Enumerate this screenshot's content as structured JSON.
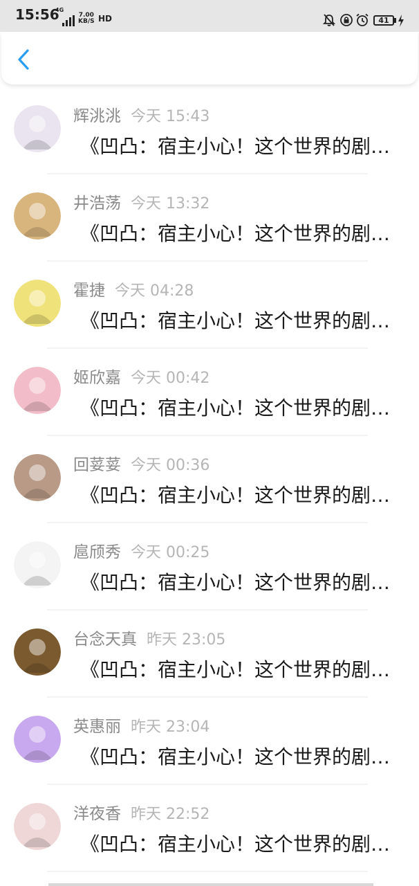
{
  "status_bar": {
    "time": "15:56",
    "network": "4G",
    "speed_value": "7.00",
    "speed_unit": "KB/S",
    "hd": "HD",
    "battery": "41"
  },
  "header": {
    "back_icon": "chevron-left-icon"
  },
  "messages": [
    {
      "name": "辉洮洮",
      "time": "今天 15:43",
      "text": "《凹凸：宿主小心！这个世界的剧情已经崩坏》",
      "avatar_color": "#e9e4ef"
    },
    {
      "name": "井浩荡",
      "time": "今天 13:32",
      "text": "《凹凸：宿主小心！这个世界的剧情已经崩坏》",
      "avatar_color": "#d9b57e"
    },
    {
      "name": "霍捷",
      "time": "今天 04:28",
      "text": "《凹凸：宿主小心！这个世界的剧情已经崩坏》",
      "avatar_color": "#f0e27a"
    },
    {
      "name": "姬欣嘉",
      "time": "今天 00:42",
      "text": "《凹凸：宿主小心！这个世界的剧情已经崩坏》",
      "avatar_color": "#f2bcc8"
    },
    {
      "name": "回荽荽",
      "time": "今天 00:36",
      "text": "《凹凸：宿主小心！这个世界的剧情已经崩坏》",
      "avatar_color": "#b89a86"
    },
    {
      "name": "扈颀秀",
      "time": "今天 00:25",
      "text": "《凹凸：宿主小心！这个世界的剧情已经崩坏》",
      "avatar_color": "#f4f4f4"
    },
    {
      "name": "台念天真",
      "time": "昨天 23:05",
      "text": "《凹凸：宿主小心！这个世界的剧情已经崩坏》",
      "avatar_color": "#7a5a2e"
    },
    {
      "name": "英惠丽",
      "time": "昨天 23:04",
      "text": "《凹凸：宿主小心！这个世界的剧情已经崩坏》",
      "avatar_color": "#c8a8ef"
    },
    {
      "name": "洋夜香",
      "time": "昨天 22:52",
      "text": "《凹凸：宿主小心！这个世界的剧情已经崩坏》",
      "avatar_color": "#efd7d7"
    }
  ],
  "colors": {
    "accent": "#2a9df4",
    "name_text": "#8a8a8a",
    "time_text": "#b5b5b5",
    "message_text": "#1a1a1a"
  }
}
